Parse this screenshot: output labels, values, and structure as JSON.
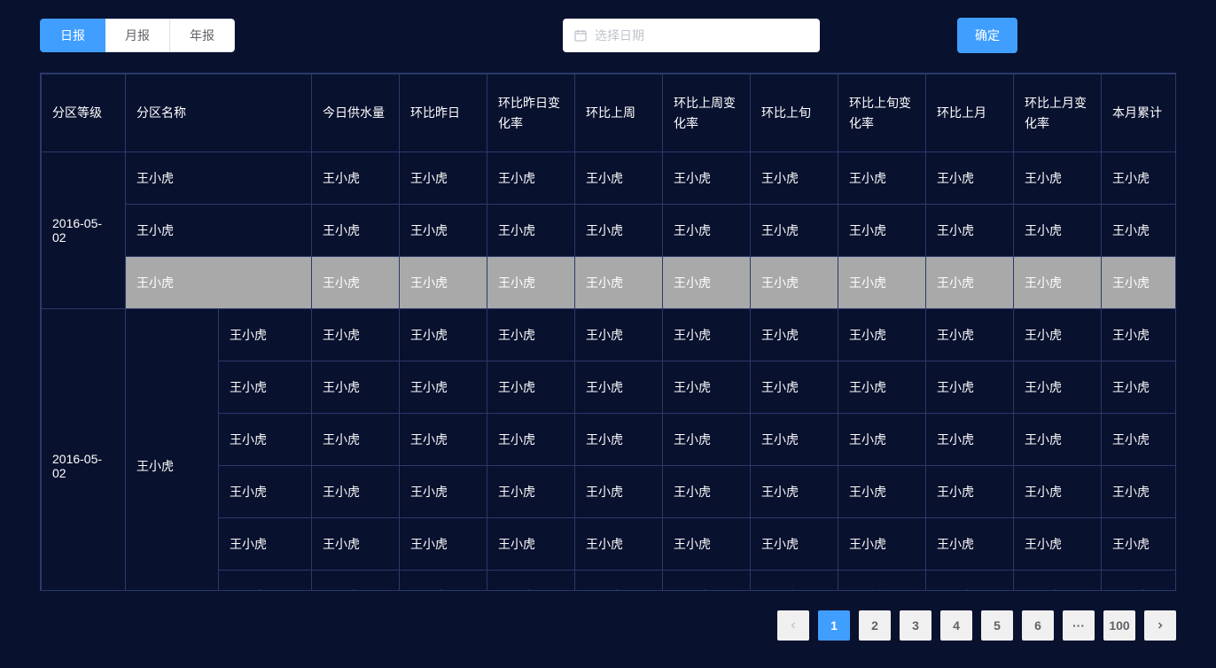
{
  "toolbar": {
    "tabs": [
      {
        "label": "日报",
        "active": true
      },
      {
        "label": "月报",
        "active": false
      },
      {
        "label": "年报",
        "active": false
      }
    ],
    "date_placeholder": "选择日期",
    "confirm_label": "确定"
  },
  "table": {
    "headers": [
      "分区等级",
      "分区名称",
      "今日供水量",
      "环比昨日",
      "环比昨日变化率",
      "环比上周",
      "环比上周变化率",
      "环比上旬",
      "环比上旬变化率",
      "环比上月",
      "环比上月变化率",
      "本月累计"
    ],
    "groups": [
      {
        "level": "2016-05-02",
        "rows": [
          {
            "name_span": 2,
            "name": "王小虎",
            "cells": [
              "王小虎",
              "王小虎",
              "王小虎",
              "王小虎",
              "王小虎",
              "王小虎",
              "王小虎",
              "王小虎",
              "王小虎",
              "王小虎"
            ],
            "hover": false
          },
          {
            "name_span": 2,
            "name": "王小虎",
            "cells": [
              "王小虎",
              "王小虎",
              "王小虎",
              "王小虎",
              "王小虎",
              "王小虎",
              "王小虎",
              "王小虎",
              "王小虎",
              "王小虎"
            ],
            "hover": false
          },
          {
            "name_span": 2,
            "name": "王小虎",
            "cells": [
              "王小虎",
              "王小虎",
              "王小虎",
              "王小虎",
              "王小虎",
              "王小虎",
              "王小虎",
              "王小虎",
              "王小虎",
              "王小虎"
            ],
            "hover": true
          }
        ]
      },
      {
        "level": "2016-05-02",
        "name_col": "王小虎",
        "rows": [
          {
            "name": "王小虎",
            "cells": [
              "王小虎",
              "王小虎",
              "王小虎",
              "王小虎",
              "王小虎",
              "王小虎",
              "王小虎",
              "王小虎",
              "王小虎",
              "王小虎"
            ]
          },
          {
            "name": "王小虎",
            "cells": [
              "王小虎",
              "王小虎",
              "王小虎",
              "王小虎",
              "王小虎",
              "王小虎",
              "王小虎",
              "王小虎",
              "王小虎",
              "王小虎"
            ]
          },
          {
            "name": "王小虎",
            "cells": [
              "王小虎",
              "王小虎",
              "王小虎",
              "王小虎",
              "王小虎",
              "王小虎",
              "王小虎",
              "王小虎",
              "王小虎",
              "王小虎"
            ]
          },
          {
            "name": "王小虎",
            "cells": [
              "王小虎",
              "王小虎",
              "王小虎",
              "王小虎",
              "王小虎",
              "王小虎",
              "王小虎",
              "王小虎",
              "王小虎",
              "王小虎"
            ]
          },
          {
            "name": "王小虎",
            "cells": [
              "王小虎",
              "王小虎",
              "王小虎",
              "王小虎",
              "王小虎",
              "王小虎",
              "王小虎",
              "王小虎",
              "王小虎",
              "王小虎"
            ]
          },
          {
            "name": "王小虎",
            "cells": [
              "王小虎",
              "王小虎",
              "王小虎",
              "王小虎",
              "王小虎",
              "王小虎",
              "王小虎",
              "王小虎",
              "王小虎",
              "王小虎"
            ]
          }
        ]
      }
    ]
  },
  "pagination": {
    "pages": [
      "1",
      "2",
      "3",
      "4",
      "5",
      "6",
      "···",
      "100"
    ],
    "active": "1"
  }
}
